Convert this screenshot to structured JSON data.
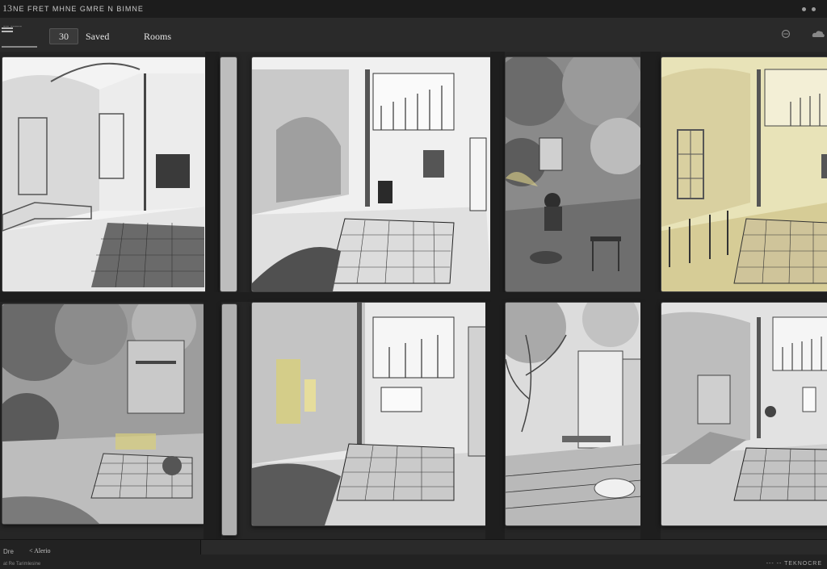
{
  "window": {
    "app_glyph": "13",
    "title": "NE FRET MHNE GMRE N BIMNE"
  },
  "toolbar": {
    "menu_text": "--- ------",
    "count_value": "30",
    "tab_primary": "Saved",
    "tab_secondary": "Rooms"
  },
  "gallery": {
    "images": [
      {
        "tone": "grayscale",
        "scene": "interior-sketch"
      },
      {
        "tone": "grayscale",
        "scene": "interior-sketch"
      },
      {
        "tone": "grayscale",
        "scene": "courtyard-sketch"
      },
      {
        "tone": "sepia-yellow",
        "scene": "interior-sketch"
      },
      {
        "tone": "grayscale",
        "scene": "courtyard-sketch"
      },
      {
        "tone": "grayscale-yellow",
        "scene": "interior-sketch"
      },
      {
        "tone": "grayscale",
        "scene": "courtyard-sketch"
      },
      {
        "tone": "grayscale",
        "scene": "interior-sketch"
      }
    ]
  },
  "status": {
    "left_top": "Dre",
    "left_label": "&lt;  Alerio",
    "bottom_text": "at Re Tarimlesine",
    "right_text": "--- -- TEKNOCRE"
  },
  "colors": {
    "background": "#2c2c2c",
    "titlebar": "#1c1c1c",
    "accent_yellow": "#d8cf7a"
  }
}
